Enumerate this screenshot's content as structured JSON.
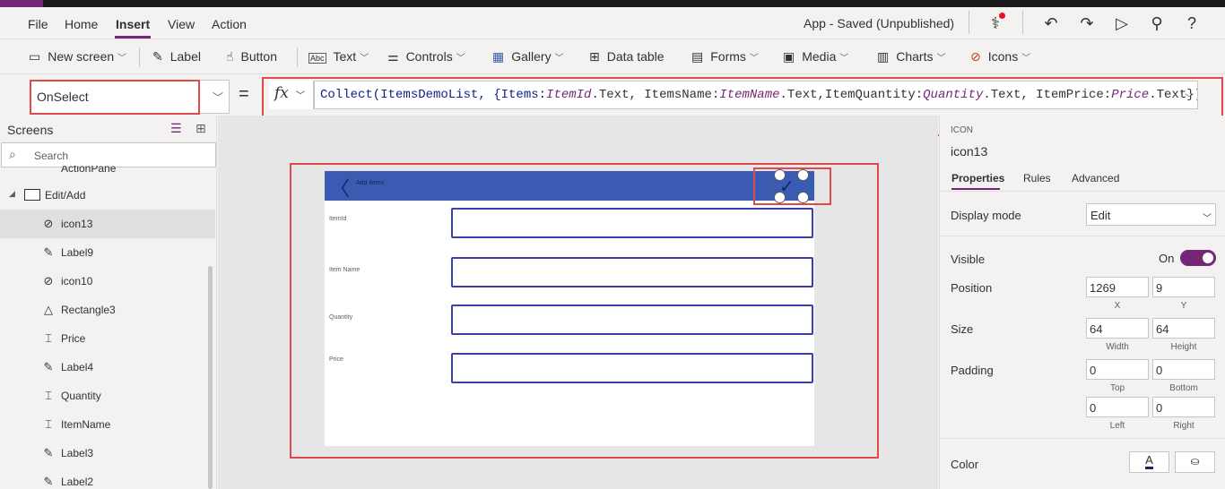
{
  "menu": {
    "items": [
      "File",
      "Home",
      "Insert",
      "View",
      "Action"
    ],
    "active": "Insert",
    "app_status": "App - Saved (Unpublished)"
  },
  "toolbar_icons": [
    "stethoscope-icon",
    "undo-icon",
    "redo-icon",
    "play-icon",
    "user-add-icon",
    "help-icon"
  ],
  "ribbon": {
    "new_screen": "New screen",
    "label": "Label",
    "button": "Button",
    "text": "Text",
    "controls": "Controls",
    "gallery": "Gallery",
    "data_table": "Data table",
    "forms": "Forms",
    "media": "Media",
    "charts": "Charts",
    "icons": "Icons"
  },
  "formula_bar": {
    "property": "OnSelect",
    "equals": "=",
    "fx": "fx",
    "formula_parts": {
      "p1": "Collect(ItemsDemoList, {Items:",
      "p2": "ItemId",
      "p3": ".Text, ItemsName:",
      "p4": "ItemName",
      "p5": ".Text,ItemQuantity:",
      "p6": "Quantity",
      "p7": ".Text, ItemPrice:",
      "p8": "Price",
      "p9": ".Text})"
    }
  },
  "left_panel": {
    "title": "Screens",
    "search_placeholder": "Search",
    "partial_item": "ActionPane",
    "screen_item": "Edit/Add",
    "items": [
      {
        "label": "icon13",
        "icon": "icons-control-icon",
        "glyph": "⊘",
        "selected": true
      },
      {
        "label": "Label9",
        "icon": "label-icon",
        "glyph": "✎",
        "selected": false
      },
      {
        "label": "icon10",
        "icon": "icons-control-icon",
        "glyph": "⊘",
        "selected": false
      },
      {
        "label": "Rectangle3",
        "icon": "shape-icon",
        "glyph": "△",
        "selected": false
      },
      {
        "label": "Price",
        "icon": "text-input-icon",
        "glyph": "⌶",
        "selected": false
      },
      {
        "label": "Label4",
        "icon": "label-icon",
        "glyph": "✎",
        "selected": false
      },
      {
        "label": "Quantity",
        "icon": "text-input-icon",
        "glyph": "⌶",
        "selected": false
      },
      {
        "label": "ItemName",
        "icon": "text-input-icon",
        "glyph": "⌶",
        "selected": false
      },
      {
        "label": "Label3",
        "icon": "label-icon",
        "glyph": "✎",
        "selected": false
      },
      {
        "label": "Label2",
        "icon": "label-icon",
        "glyph": "✎",
        "selected": false
      }
    ]
  },
  "canvas": {
    "header_title": "Add items",
    "fields": [
      "ItemId",
      "Item Name",
      "Quantity",
      "Price"
    ]
  },
  "right_panel": {
    "kind": "ICON",
    "name": "icon13",
    "tabs": [
      "Properties",
      "Rules",
      "Advanced"
    ],
    "display_mode_label": "Display mode",
    "display_mode_value": "Edit",
    "visible_label": "Visible",
    "visible_value": "On",
    "position_label": "Position",
    "position_x": "1269",
    "position_y": "9",
    "x_label": "X",
    "y_label": "Y",
    "size_label": "Size",
    "width": "64",
    "height": "64",
    "width_label": "Width",
    "height_label": "Height",
    "padding_label": "Padding",
    "pad_top": "0",
    "pad_bottom": "0",
    "pad_left": "0",
    "pad_right": "0",
    "top_label": "Top",
    "bottom_label": "Bottom",
    "left_label": "Left",
    "right_label": "Right",
    "color_label": "Color",
    "color_glyph": "A"
  },
  "colors": {
    "accent": "#742774",
    "header_blue": "#3b5ab1",
    "highlight_red": "#e04a4a"
  }
}
